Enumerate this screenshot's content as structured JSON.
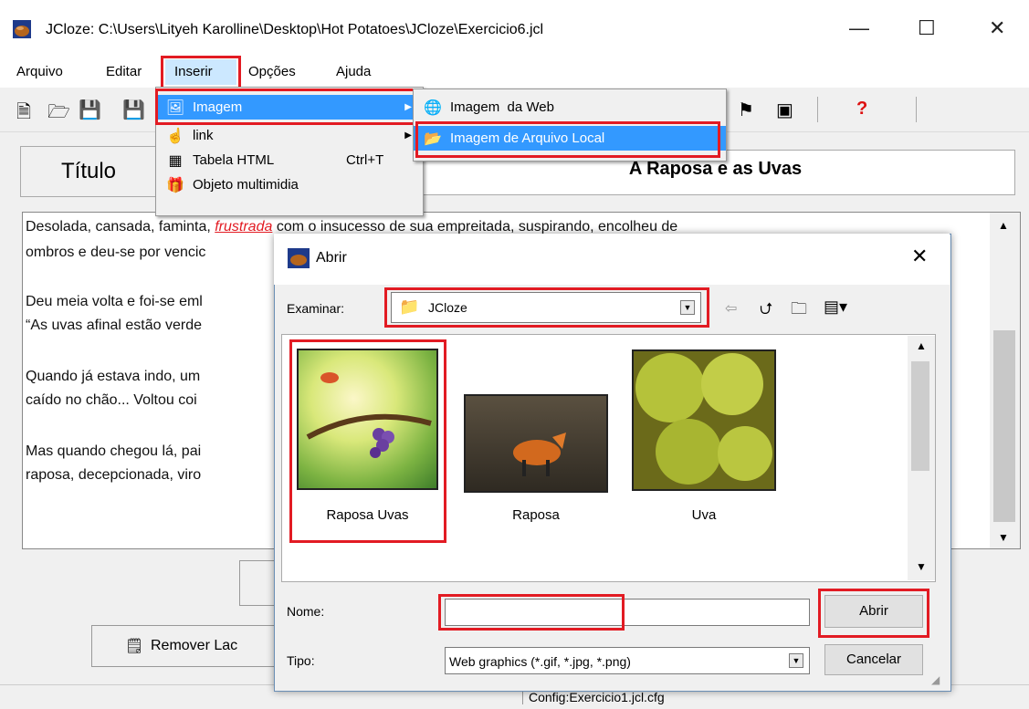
{
  "window": {
    "title": "JCloze: C:\\Users\\Lityeh Karolline\\Desktop\\Hot Potatoes\\JCloze\\Exercicio6.jcl",
    "minimize": "—",
    "maximize": "☐",
    "close": "✕"
  },
  "menubar": [
    "Arquivo",
    "Editar",
    "Inserir",
    "Opções",
    "Ajuda"
  ],
  "inserir_menu": {
    "items": [
      {
        "label": "Imagem",
        "shortcut": "",
        "icon": "image-icon",
        "submenu": true
      },
      {
        "label": "link",
        "shortcut": "",
        "icon": "hand-pointer-icon",
        "submenu": true
      },
      {
        "label": "Tabela HTML",
        "shortcut": "Ctrl+T",
        "icon": "table-grid-icon",
        "submenu": false
      },
      {
        "label": "Objeto multimidia",
        "shortcut": "",
        "icon": "gift-icon",
        "submenu": false
      }
    ]
  },
  "imagem_submenu": {
    "items": [
      {
        "label": "Imagem  da Web",
        "icon": "web-image-icon"
      },
      {
        "label": "Imagem de Arquivo Local",
        "icon": "folder-image-icon"
      }
    ]
  },
  "editor": {
    "title_button": "Título",
    "title_value": "A Raposa e as Uvas",
    "text": {
      "line1_a": "Desolada, cansada, faminta, ",
      "line1_b": "frustrada",
      "line1_c": " com o insucesso de sua empreitada, suspirando, encolheu de",
      "line2": "ombros e deu-se por vencic",
      "line3": "Deu meia volta e foi-se eml",
      "line4": "“As uvas afinal estão verde",
      "line5": "Quando já estava indo, um",
      "line6": "caído no chão... Voltou coi",
      "line7": "Mas quando chegou lá, pai",
      "line8": "raposa, decepcionada, viro"
    },
    "remove_button": "Remover Lac",
    "status_text": "Config:Exercicio1.jcl.cfg"
  },
  "dialog": {
    "title": "Abrir",
    "close": "✕",
    "look_in_label": "Examinar:",
    "look_in_value": "JCloze",
    "files": [
      {
        "name": "Raposa Uvas"
      },
      {
        "name": "Raposa"
      },
      {
        "name": "Uva"
      }
    ],
    "name_label": "Nome:",
    "name_value": "",
    "type_label": "Tipo:",
    "type_value": "Web graphics (*.gif, *.jpg, *.png)",
    "open_button": "Abrir",
    "cancel_button": "Cancelar"
  },
  "colors": {
    "highlight_box": "#e21b23",
    "menu_selection": "#3399ff",
    "italic_word": "#e21b23"
  }
}
